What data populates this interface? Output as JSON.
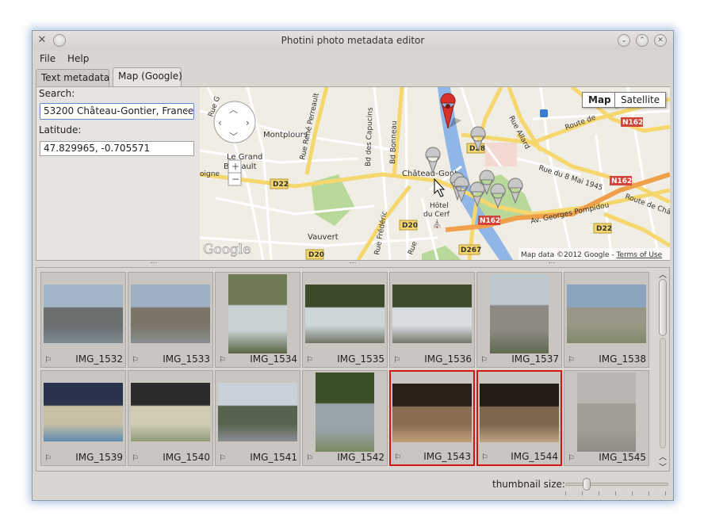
{
  "window": {
    "title": "Photini photo metadata editor"
  },
  "menu": {
    "file": "File",
    "help": "Help"
  },
  "tabs": [
    {
      "label": "Text metadata",
      "active": false
    },
    {
      "label": "Map (Google)",
      "active": true
    }
  ],
  "map_tab": {
    "search_label": "Search:",
    "search_value": "53200 Château-Gontier, France",
    "latitude_label": "Latitude:",
    "latitude_value": "47.829965, -0.705571",
    "map_button": "Map",
    "satellite_button": "Satellite",
    "map_labels": {
      "montplours": "Montplours",
      "le_grand": "Le Grand",
      "bignault": "Bignault",
      "chateau": "Château-Gont",
      "hotel": "Hôtel",
      "du_cerf": "du Cerf",
      "vauvert": "Vauvert",
      "av_pompidou": "Av. Georges Pompidou",
      "rue_8_mai": "Rue du 8 Mai 1945",
      "route_de": "Route de",
      "route_chat": "Route de Châte",
      "rue_rene": "Rue René Perreault",
      "bd_capucins": "Bd des Capucins",
      "bd_bonneau": "Bd Bonneau",
      "rue_allard": "Rue Allard",
      "rue_frederic": "Rue Frédéric",
      "rue_g": "Rue G",
      "rue": "Rue",
      "oigne": "oigne",
      "d28": "D28",
      "d22a": "D22",
      "d22b": "D22",
      "d20a": "D20",
      "d20b": "D20",
      "d267": "D267",
      "n162a": "N162",
      "n162b": "N162",
      "n162c": "N162",
      "google": "Google",
      "attribution": "Map data ©2012 Google - ",
      "terms": "Terms of Use"
    }
  },
  "thumbnails": [
    {
      "name": "IMG_1532",
      "selected": false
    },
    {
      "name": "IMG_1533",
      "selected": false
    },
    {
      "name": "IMG_1534",
      "selected": false
    },
    {
      "name": "IMG_1535",
      "selected": false
    },
    {
      "name": "IMG_1536",
      "selected": false
    },
    {
      "name": "IMG_1537",
      "selected": false
    },
    {
      "name": "IMG_1538",
      "selected": false
    },
    {
      "name": "IMG_1539",
      "selected": false
    },
    {
      "name": "IMG_1540",
      "selected": false
    },
    {
      "name": "IMG_1541",
      "selected": false
    },
    {
      "name": "IMG_1542",
      "selected": false
    },
    {
      "name": "IMG_1543",
      "selected": true
    },
    {
      "name": "IMG_1544",
      "selected": true
    },
    {
      "name": "IMG_1545",
      "selected": false
    }
  ],
  "thumbnail_size_label": "thumbnail size:",
  "colors": {
    "selection": "#d11414",
    "marker_red": "#d8302a",
    "water": "#8fb6e6",
    "park": "#b9d99a"
  }
}
